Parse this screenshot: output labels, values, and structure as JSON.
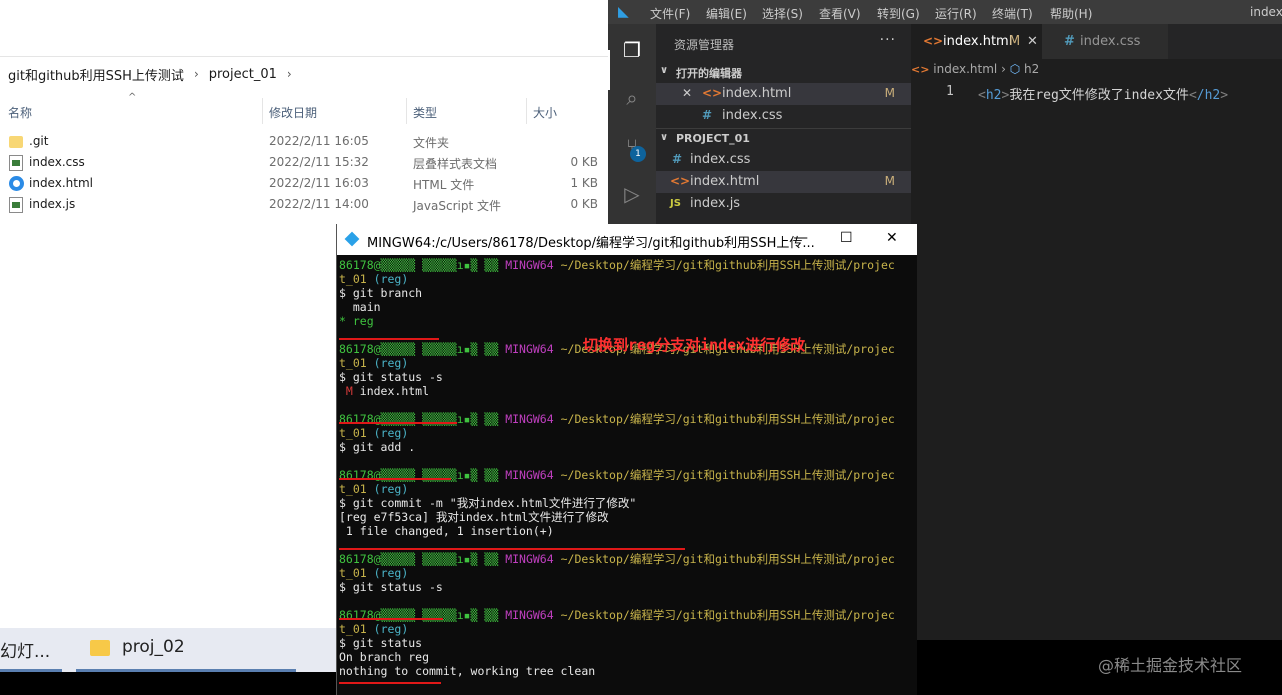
{
  "explorer": {
    "breadcrumb": [
      "git和github利用SSH上传测试",
      "project_01"
    ],
    "columns": {
      "name": "名称",
      "modified": "修改日期",
      "type": "类型",
      "size": "大小"
    },
    "files": [
      {
        "name": ".git",
        "date": "2022/2/11 16:05",
        "type": "文件夹",
        "size": "",
        "icon": "folder-icon"
      },
      {
        "name": "index.css",
        "date": "2022/2/11 15:32",
        "type": "层叠样式表文档",
        "size": "0 KB",
        "icon": "css-file-icon"
      },
      {
        "name": "index.html",
        "date": "2022/2/11 16:03",
        "type": "HTML 文件",
        "size": "1 KB",
        "icon": "edge-html-icon"
      },
      {
        "name": "index.js",
        "date": "2022/2/11 14:00",
        "type": "JavaScript 文件",
        "size": "0 KB",
        "icon": "js-file-icon"
      }
    ]
  },
  "taskbar": {
    "item1": "幻灯...",
    "item2": "proj_02"
  },
  "vscode": {
    "menu": [
      "文件(F)",
      "编辑(E)",
      "选择(S)",
      "查看(V)",
      "转到(G)",
      "运行(R)",
      "终端(T)",
      "帮助(H)"
    ],
    "title_right": "index.",
    "scm_badge": "1",
    "explorer_title": "资源管理器",
    "open_editors_label": "打开的编辑器",
    "open_editors": [
      {
        "name": "index.html",
        "mod": "M"
      },
      {
        "name": "index.css",
        "mod": ""
      }
    ],
    "project_label": "PROJECT_01",
    "project_files": [
      {
        "name": "index.css",
        "mod": ""
      },
      {
        "name": "index.html",
        "mod": "M"
      },
      {
        "name": "index.js",
        "mod": ""
      }
    ],
    "tabs": [
      {
        "name": "index.html",
        "mod": "M"
      },
      {
        "name": "index.css",
        "mod": ""
      }
    ],
    "breadcrumb": [
      "index.html",
      "h2"
    ],
    "line_number": "1",
    "code": {
      "open_tag": "h2",
      "text": "我在reg文件修改了index文件",
      "close_tag": "/h2"
    }
  },
  "terminal": {
    "title": "MINGW64:/c/Users/86178/Desktop/编程学习/git和github利用SSH上传...",
    "prompt_user": "86178@▒▒▒▒▒ ▒▒▒▒▒ı▪▒ ▒▒",
    "prompt_host": "MINGW64",
    "prompt_path": "~/Desktop/编程学习/git和github利用SSH上传测试/projec",
    "prompt_path2": "t_01",
    "branch": "(reg)",
    "annotation": "切换到reg分支对index进行修改",
    "cmd_branch": "$ git branch",
    "out_main": "  main",
    "out_reg": "* reg",
    "cmd_status_s": "$ git status -s",
    "out_status_flag": " M",
    "out_status_file": " index.html",
    "cmd_add": "$ git add .",
    "cmd_commit": "$ git commit -m \"我对index.html文件进行了修改\"",
    "out_commit1": "[reg e7f53ca] 我对index.html文件进行了修改",
    "out_commit2": " 1 file changed, 1 insertion(+)",
    "cmd_status_s2": "$ git status -s",
    "cmd_status": "$ git status",
    "out_on_branch": "On branch reg",
    "out_clean": "nothing to commit, working tree clean"
  },
  "watermark": "@稀土掘金技术社区"
}
